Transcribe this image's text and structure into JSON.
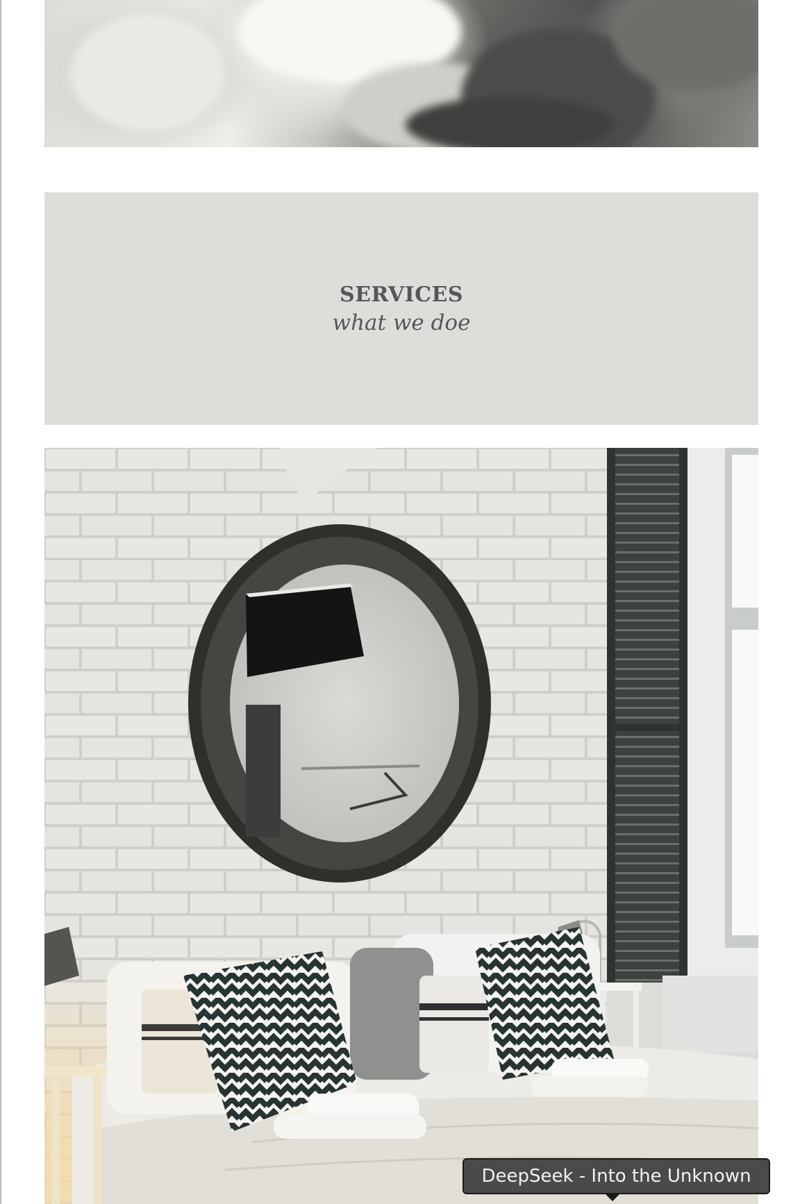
{
  "services": {
    "title": "SERVICES",
    "subtitle": "what we doe"
  },
  "tooltip": {
    "text": "DeepSeek - Into the Unknown"
  },
  "images": {
    "top": "bedding-photo",
    "bottom": "bedroom-photo"
  },
  "colors": {
    "services_background": "#dcdeda",
    "services_text": "#55565c",
    "tooltip_background": "#4a4a4a"
  }
}
